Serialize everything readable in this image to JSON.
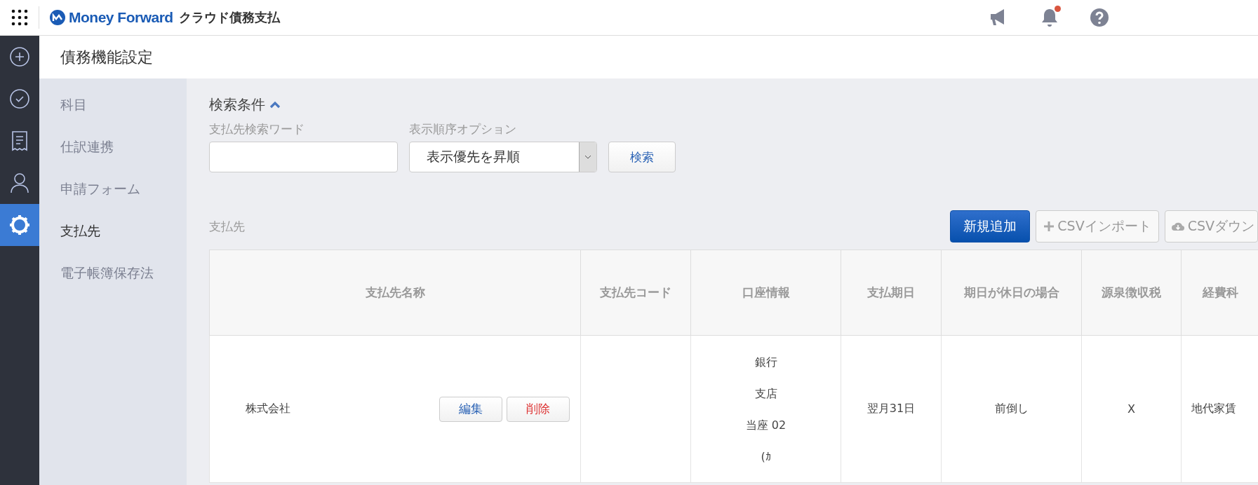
{
  "topbar": {
    "brand": "Money Forward",
    "product": "クラウド債務支払",
    "notification_badge": true
  },
  "rail": [
    {
      "kind": "plus",
      "selected": false
    },
    {
      "kind": "check",
      "selected": false
    },
    {
      "kind": "receipt",
      "selected": false
    },
    {
      "kind": "user",
      "selected": false
    },
    {
      "kind": "gear",
      "selected": true
    }
  ],
  "page_title": "債務機能設定",
  "subnav": [
    {
      "label": "科目",
      "selected": false
    },
    {
      "label": "仕訳連携",
      "selected": false
    },
    {
      "label": "申請フォーム",
      "selected": false
    },
    {
      "label": "支払先",
      "selected": true
    },
    {
      "label": "電子帳簿保存法",
      "selected": false
    }
  ],
  "search": {
    "title": "検索条件",
    "expanded": true,
    "keyword_label": "支払先検索ワード",
    "sort_label": "表示順序オプション",
    "sort_value": "表示優先を昇順",
    "button": "検索"
  },
  "list": {
    "title": "支払先",
    "actions": [
      {
        "label": "新規追加",
        "kind": "primary"
      },
      {
        "label": "CSVインポート",
        "kind": "import"
      },
      {
        "label": "CSVダウン",
        "kind": "download"
      }
    ]
  },
  "table": {
    "columns": [
      "支払先名称",
      "支払先コード",
      "口座情報",
      "支払期日",
      "期日が休日の場合",
      "源泉徴収税",
      "経費科"
    ],
    "rows": [
      {
        "name": "株式会社",
        "edit": "編集",
        "delete": "削除",
        "bank": [
          "銀行",
          "支店",
          "当座 02",
          "(ｶ"
        ],
        "due": "翌月31日",
        "holiday": "前倒し",
        "withholding": "X",
        "expense": "地代家賃"
      }
    ]
  }
}
